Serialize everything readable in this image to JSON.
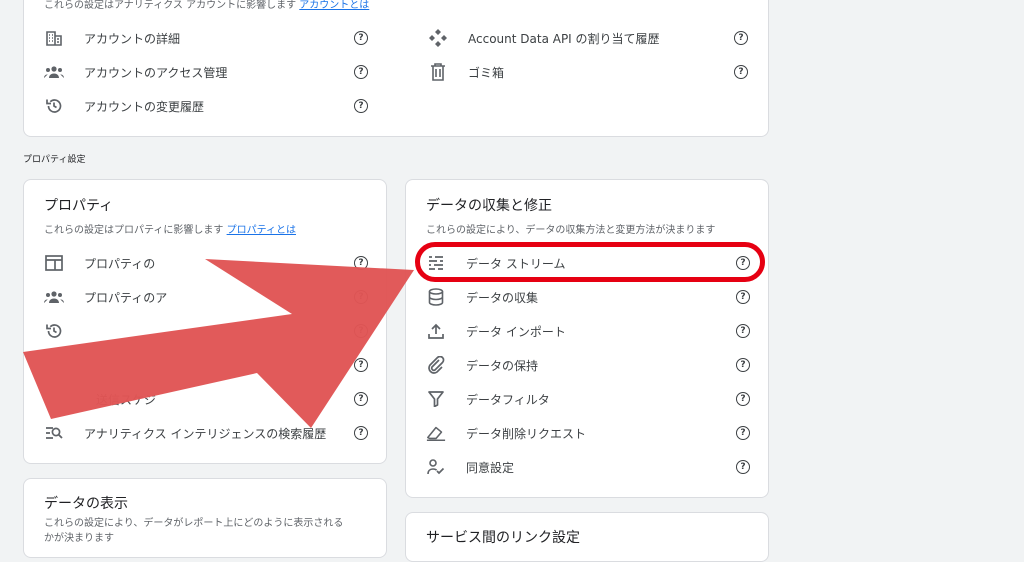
{
  "account_card": {
    "desc": "これらの設定はアナリティクス アカウントに影響します",
    "desc_link": "アカウントとは",
    "left_items": [
      {
        "label": "アカウントの詳細",
        "icon": "building-icon"
      },
      {
        "label": "アカウントのアクセス管理",
        "icon": "people-icon"
      },
      {
        "label": "アカウントの変更履歴",
        "icon": "history-icon"
      }
    ],
    "right_items": [
      {
        "label": "Account Data API の割り当て履歴",
        "icon": "api-icon"
      },
      {
        "label": "ゴミ箱",
        "icon": "trash-icon"
      }
    ]
  },
  "property_section_label": "プロパティ設定",
  "property_card": {
    "title": "プロパティ",
    "desc": "これらの設定はプロパティに影響します",
    "desc_link": "プロパティとは",
    "items": [
      {
        "label": "プロパティの",
        "icon": "property-icon"
      },
      {
        "label": "プロパティのア",
        "icon": "people-icon"
      },
      {
        "label": "",
        "icon": "history-icon"
      },
      {
        "label": "",
        "icon": "blank"
      },
      {
        "label": "送信スケジ",
        "icon": "blank"
      },
      {
        "label": "アナリティクス インテリジェンスの検索履歴",
        "icon": "search-history-icon"
      }
    ]
  },
  "data_collection_card": {
    "title": "データの収集と修正",
    "desc": "これらの設定により、データの収集方法と変更方法が決まります",
    "items": [
      {
        "label": "データ ストリーム",
        "icon": "streams-icon"
      },
      {
        "label": "データの収集",
        "icon": "database-icon"
      },
      {
        "label": "データ インポート",
        "icon": "upload-icon"
      },
      {
        "label": "データの保持",
        "icon": "clip-icon"
      },
      {
        "label": "データフィルタ",
        "icon": "filter-icon"
      },
      {
        "label": "データ削除リクエスト",
        "icon": "eraser-icon"
      },
      {
        "label": "同意設定",
        "icon": "consent-icon"
      }
    ]
  },
  "data_display_card": {
    "title": "データの表示",
    "desc": "これらの設定により、データがレポート上にどのように表示される",
    "desc2": "かが決まります"
  },
  "service_links_card": {
    "title": "サービス間のリンク設定"
  },
  "help_glyph": "?",
  "colors": {
    "highlight": "#e60012",
    "arrow": "#e05555",
    "link": "#1a73e8"
  }
}
